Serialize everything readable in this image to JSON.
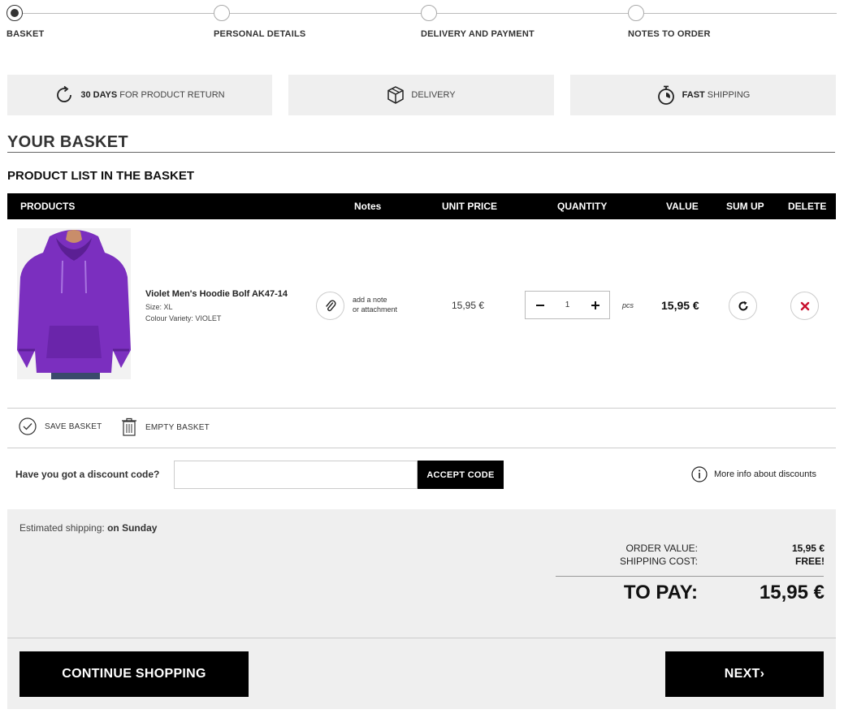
{
  "steps": [
    {
      "label": "BASKET",
      "active": true
    },
    {
      "label": "PERSONAL DETAILS",
      "active": false
    },
    {
      "label": "DELIVERY AND PAYMENT",
      "active": false
    },
    {
      "label": "NOTES TO ORDER",
      "active": false
    }
  ],
  "info_boxes": {
    "returns": {
      "bold": "30 DAYS",
      "text": "FOR PRODUCT RETURN",
      "icon": "return-arrow-icon"
    },
    "delivery": {
      "text": "DELIVERY",
      "icon": "box-icon"
    },
    "shipping": {
      "bold": "FAST",
      "text": "SHIPPING",
      "icon": "stopwatch-icon"
    }
  },
  "page_title": "YOUR BASKET",
  "section_title": "PRODUCT LIST IN THE BASKET",
  "table_headers": {
    "products": "PRODUCTS",
    "notes": "Notes",
    "unit_price": "UNIT PRICE",
    "quantity": "QUANTITY",
    "value": "VALUE",
    "sum_up": "SUM UP",
    "delete": "DELETE"
  },
  "product": {
    "name": "Violet Men's Hoodie Bolf AK47-14",
    "size": "Size: XL",
    "colour": "Colour Variety: VIOLET",
    "note_line1": "add a note",
    "note_line2": "or attachment",
    "unit_price": "15,95 €",
    "quantity": "1",
    "unit": "pcs",
    "value": "15,95 €",
    "image_color": "#7b2fbf"
  },
  "basket_actions": {
    "save": "SAVE BASKET",
    "empty": "EMPTY BASKET"
  },
  "discount": {
    "label": "Have you got a discount code?",
    "input_value": "",
    "button": "ACCEPT CODE",
    "more_info": "More info about discounts"
  },
  "summary": {
    "estimated_label": "Estimated shipping:",
    "estimated_value": "on Sunday",
    "order_value_label": "ORDER VALUE:",
    "order_value": "15,95 €",
    "shipping_label": "SHIPPING COST:",
    "shipping_value": "FREE!",
    "to_pay_label": "TO PAY:",
    "to_pay_value": "15,95 €"
  },
  "buttons": {
    "continue": "CONTINUE SHOPPING",
    "next": "NEXT›"
  },
  "colors": {
    "delete_x": "#c8102e",
    "black": "#000000",
    "panel_bg": "#efefef"
  }
}
